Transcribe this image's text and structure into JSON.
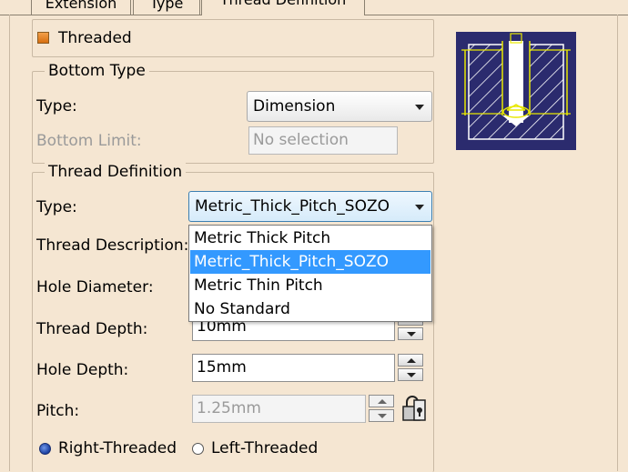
{
  "tabs": [
    {
      "label": "Extension"
    },
    {
      "label": "Type"
    },
    {
      "label": "Thread Definition"
    }
  ],
  "threaded": {
    "label": "Threaded",
    "checked": true
  },
  "bottom_type": {
    "legend": "Bottom Type",
    "type_label": "Type:",
    "type_value": "Dimension",
    "limit_label": "Bottom Limit:",
    "limit_value": "No selection"
  },
  "thread_definition": {
    "legend": "Thread Definition",
    "type_label": "Type:",
    "type_value": "Metric_Thick_Pitch_SOZO",
    "description_label": "Thread Description:",
    "hole_diameter_label": "Hole Diameter:",
    "thread_depth_label": "Thread Depth:",
    "thread_depth_value": "10mm",
    "hole_depth_label": "Hole Depth:",
    "hole_depth_value": "15mm",
    "pitch_label": "Pitch:",
    "pitch_value": "1.25mm"
  },
  "type_dropdown": {
    "options": [
      "Metric Thick Pitch",
      "Metric_Thick_Pitch_SOZO",
      "Metric Thin Pitch",
      "No Standard"
    ],
    "selected_index": 1
  },
  "direction": {
    "right_label": "Right-Threaded",
    "left_label": "Left-Threaded",
    "selected": "right"
  },
  "colors": {
    "background": "#f5e6d2",
    "preview_bg": "#2b2b6e",
    "preview_accent": "#e8e800",
    "selection": "#3399ff",
    "checkbox": "#e07a10",
    "radio_selected": "#1a3fa0"
  }
}
